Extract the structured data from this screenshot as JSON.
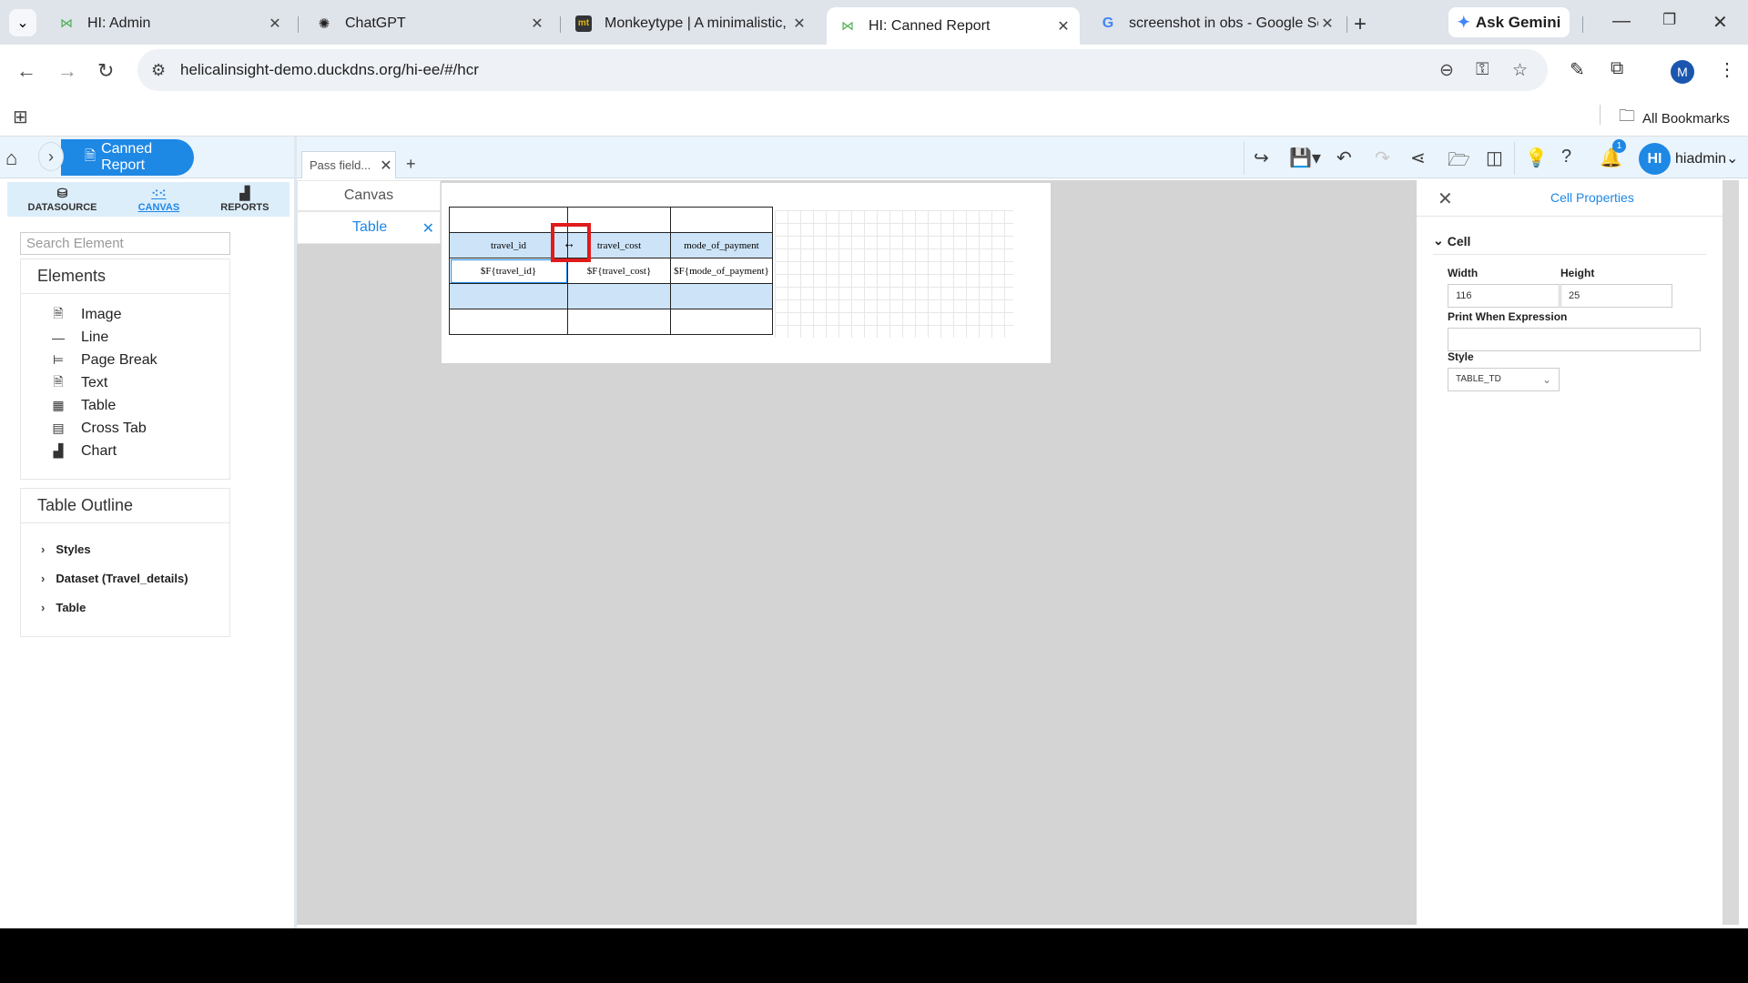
{
  "browser": {
    "tabs": [
      {
        "title": "HI: Admin",
        "icon": "helical-logo-icon"
      },
      {
        "title": "ChatGPT",
        "icon": "chatgpt-logo-icon"
      },
      {
        "title": "Monkeytype | A minimalistic, c",
        "icon": "monkeytype-logo-icon"
      },
      {
        "title": "HI: Canned Report",
        "icon": "helical-logo-icon",
        "active": true
      },
      {
        "title": "screenshot in obs - Google Se",
        "icon": "google-logo-icon"
      }
    ],
    "gemini_label": "Ask Gemini",
    "url": "helicalinsight-demo.duckdns.org/hi-ee/#/hcr",
    "profile_initial": "M",
    "all_bookmarks": "All Bookmarks"
  },
  "app": {
    "breadcrumb": "Canned Report",
    "report_tab": "Pass field...",
    "user_avatar": "HI",
    "user_name": "hiadmin",
    "notifications_count": "1",
    "left_tabs": [
      "DATASOURCE",
      "CANVAS",
      "REPORTS"
    ],
    "search_placeholder": "Search Element",
    "elements_title": "Elements",
    "elements": [
      "Image",
      "Line",
      "Page Break",
      "Text",
      "Table",
      "Cross Tab",
      "Chart"
    ],
    "outline_title": "Table Outline",
    "outline": [
      "Styles",
      "Dataset (Travel_details)",
      "Table"
    ],
    "center_canvas_label": "Canvas",
    "center_table_label": "Table",
    "table": {
      "headers": [
        "travel_id",
        "travel_cost",
        "mode_of_payment"
      ],
      "fields": [
        "$F{travel_id}",
        "$F{travel_cost}",
        "$F{mode_of_payment}"
      ]
    },
    "cell_properties": {
      "title": "Cell Properties",
      "section": "Cell",
      "width_label": "Width",
      "width_value": "116",
      "height_label": "Height",
      "height_value": "25",
      "print_when_label": "Print When Expression",
      "style_label": "Style",
      "style_value": "TABLE_TD"
    }
  },
  "colors": {
    "accent": "#1e88e5",
    "highlight": "#e01b1b",
    "cell_fill": "#cde4f8"
  }
}
